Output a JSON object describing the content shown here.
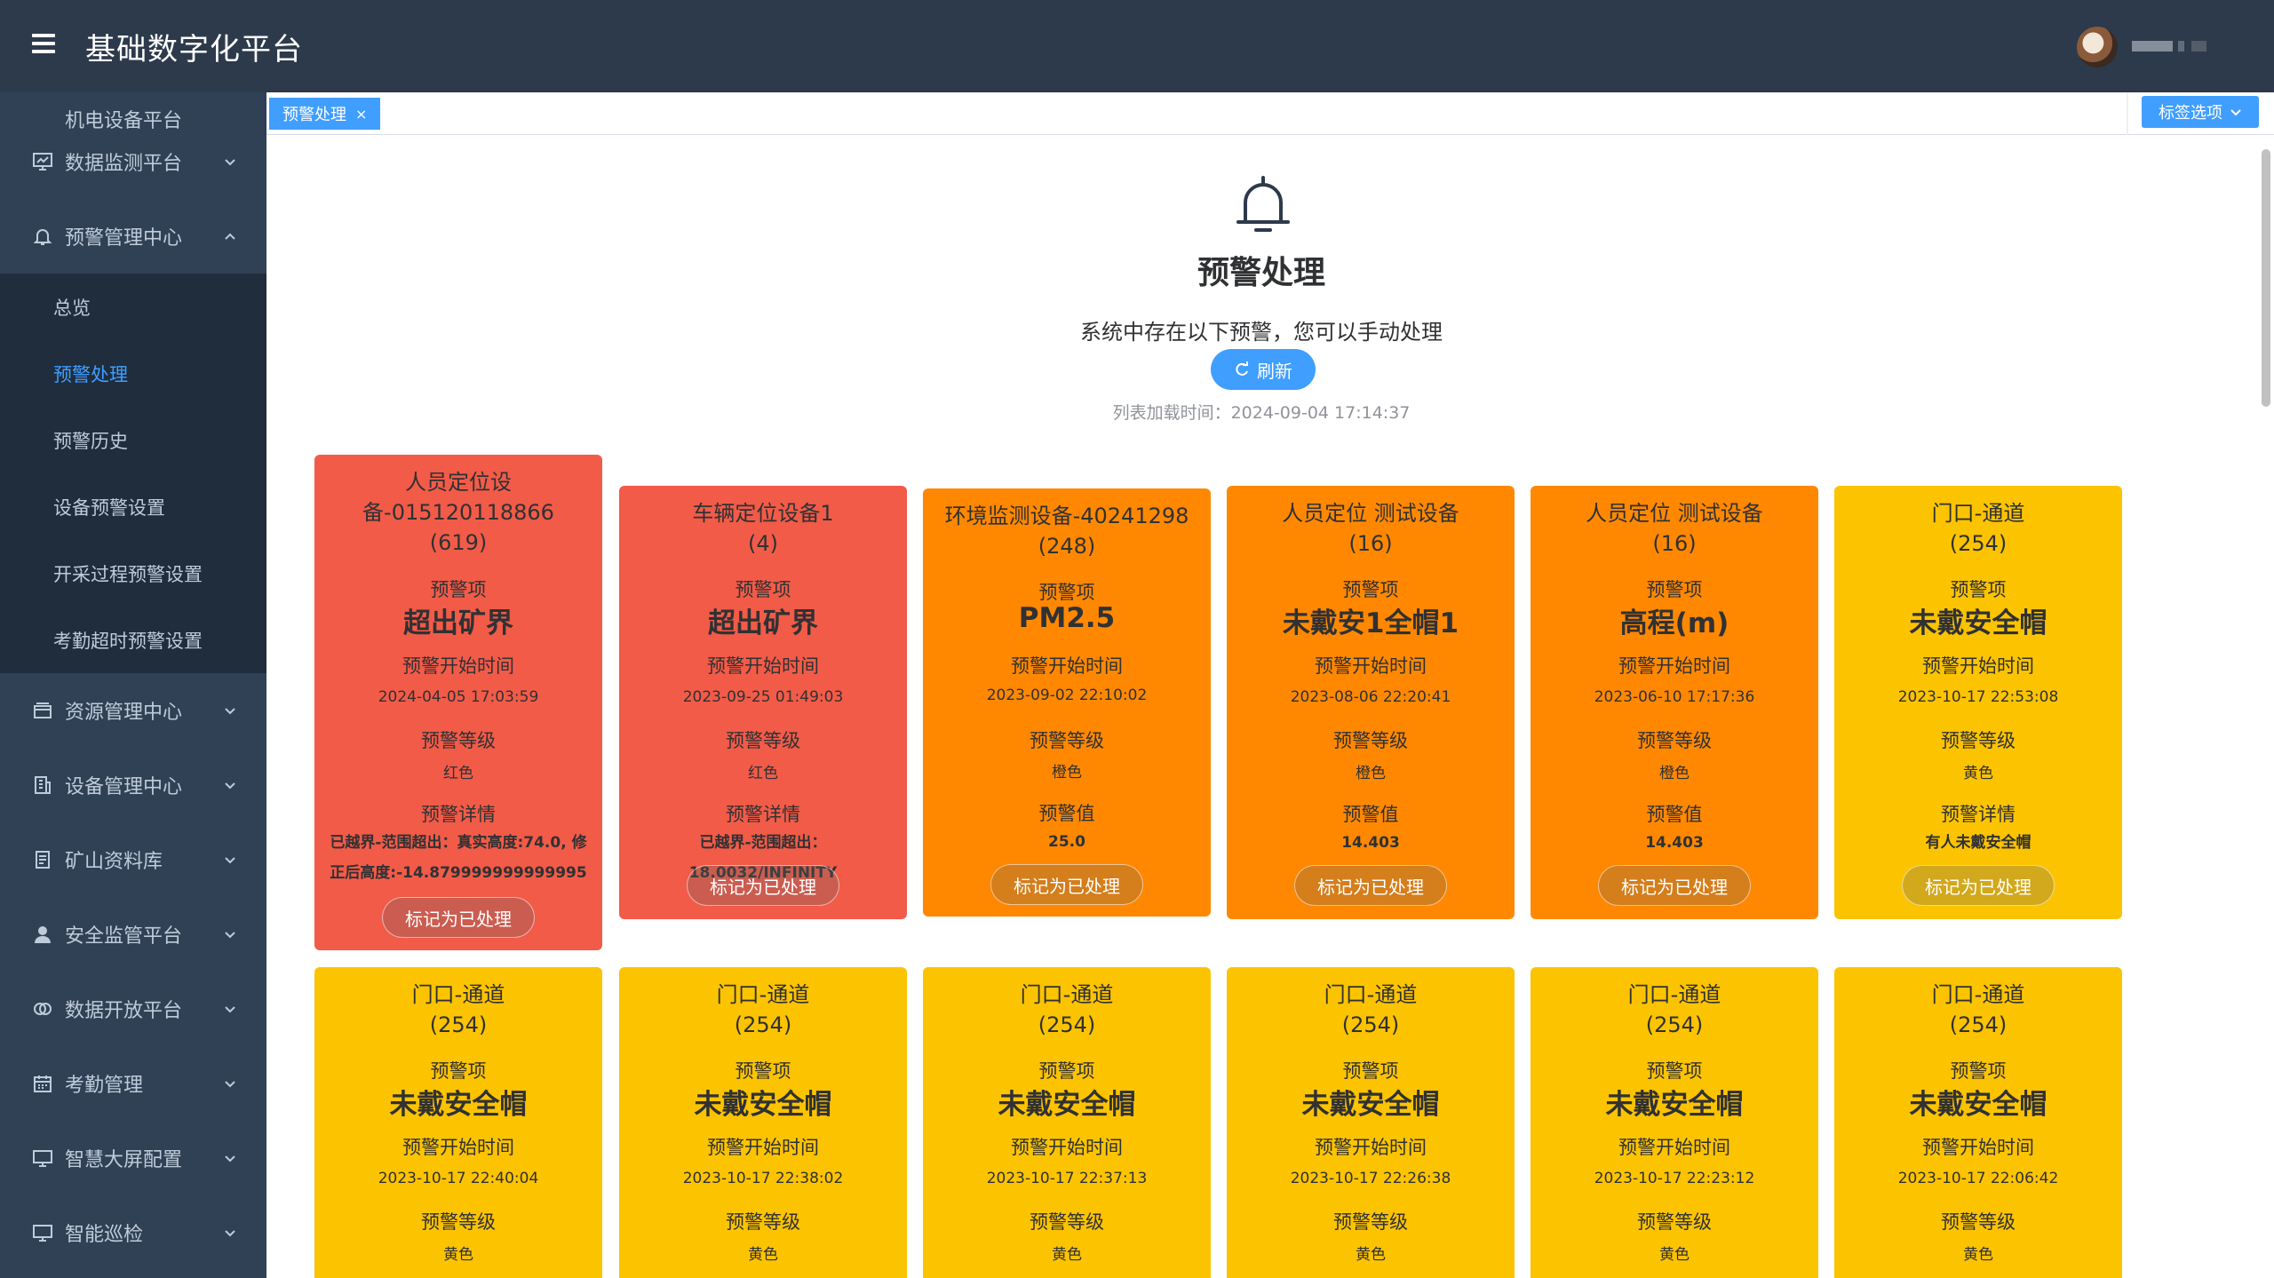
{
  "header": {
    "app_title": "基础数字化平台",
    "username": ""
  },
  "sidebar": {
    "cut_item": "机电设备平台",
    "items": [
      {
        "label": "数据监测平台",
        "icon": "monitor-chart-icon"
      },
      {
        "label": "预警管理中心",
        "icon": "bell-icon",
        "expanded": true
      },
      {
        "label": "资源管理中心",
        "icon": "box-icon"
      },
      {
        "label": "设备管理中心",
        "icon": "building-icon"
      },
      {
        "label": "矿山资料库",
        "icon": "document-icon"
      },
      {
        "label": "安全监管平台",
        "icon": "user-icon"
      },
      {
        "label": "数据开放平台",
        "icon": "data-icon"
      },
      {
        "label": "考勤管理",
        "icon": "calendar-icon"
      },
      {
        "label": "智慧大屏配置",
        "icon": "screen-icon"
      },
      {
        "label": "智能巡检",
        "icon": "screen-icon"
      }
    ],
    "sub_items": [
      "总览",
      "预警处理",
      "预警历史",
      "设备预警设置",
      "开采过程预警设置",
      "考勤超时预警设置"
    ],
    "active_sub": "预警处理"
  },
  "tags": {
    "active_tag": "预警处理",
    "options_label": "标签选项"
  },
  "main": {
    "title": "预警处理",
    "description": "系统中存在以下预警，您可以手动处理",
    "refresh_label": "刷新",
    "load_time": "列表加载时间：2024-09-04 17:14:37"
  },
  "labels": {
    "item": "预警项",
    "start_time": "预警开始时间",
    "level": "预警等级",
    "detail": "预警详情",
    "value": "预警值",
    "mark_done": "标记为已处理"
  },
  "colors": {
    "red": "#f25b48",
    "orange": "#ff8800",
    "yellow": "#fcc300",
    "accent": "#409eff"
  },
  "cards": [
    {
      "device_line1": "人员定位设",
      "device_line2": "备-015120118866",
      "count": "(619)",
      "item": "超出矿界",
      "time": "2024-04-05 17:03:59",
      "level": "红色",
      "info_type": "detail",
      "info": "已越界-范围超出：真实高度:74.0, 修正后高度:-14.879999999999995",
      "color": "red"
    },
    {
      "device_line1": "车辆定位设备1",
      "count": "(4)",
      "item": "超出矿界",
      "time": "2023-09-25 01:49:03",
      "level": "红色",
      "info_type": "detail",
      "info": "已越界-范围超出：18.0032/INFINITY",
      "color": "red"
    },
    {
      "device_line1": "环境监测设备-40241298",
      "count": "(248)",
      "item": "PM2.5",
      "time": "2023-09-02 22:10:02",
      "level": "橙色",
      "info_type": "value",
      "info": "25.0",
      "color": "orange"
    },
    {
      "device_line1": "人员定位 测试设备",
      "count": "(16)",
      "item": "未戴安1全帽1",
      "time": "2023-08-06 22:20:41",
      "level": "橙色",
      "info_type": "value",
      "info": "14.403",
      "color": "orange"
    },
    {
      "device_line1": "人员定位 测试设备",
      "count": "(16)",
      "item": "高程(m)",
      "time": "2023-06-10 17:17:36",
      "level": "橙色",
      "info_type": "value",
      "info": "14.403",
      "color": "orange"
    },
    {
      "device_line1": "门口-通道",
      "count": "(254)",
      "item": "未戴安全帽",
      "time": "2023-10-17 22:53:08",
      "level": "黄色",
      "info_type": "detail",
      "info": "有人未戴安全帽",
      "color": "yellow"
    },
    {
      "device_line1": "门口-通道",
      "count": "(254)",
      "item": "未戴安全帽",
      "time": "2023-10-17 22:40:04",
      "level": "黄色",
      "color": "yellow"
    },
    {
      "device_line1": "门口-通道",
      "count": "(254)",
      "item": "未戴安全帽",
      "time": "2023-10-17 22:38:02",
      "level": "黄色",
      "color": "yellow"
    },
    {
      "device_line1": "门口-通道",
      "count": "(254)",
      "item": "未戴安全帽",
      "time": "2023-10-17 22:37:13",
      "level": "黄色",
      "color": "yellow"
    },
    {
      "device_line1": "门口-通道",
      "count": "(254)",
      "item": "未戴安全帽",
      "time": "2023-10-17 22:26:38",
      "level": "黄色",
      "color": "yellow"
    },
    {
      "device_line1": "门口-通道",
      "count": "(254)",
      "item": "未戴安全帽",
      "time": "2023-10-17 22:23:12",
      "level": "黄色",
      "color": "yellow"
    },
    {
      "device_line1": "门口-通道",
      "count": "(254)",
      "item": "未戴安全帽",
      "time": "2023-10-17 22:06:42",
      "level": "黄色",
      "color": "yellow"
    }
  ]
}
